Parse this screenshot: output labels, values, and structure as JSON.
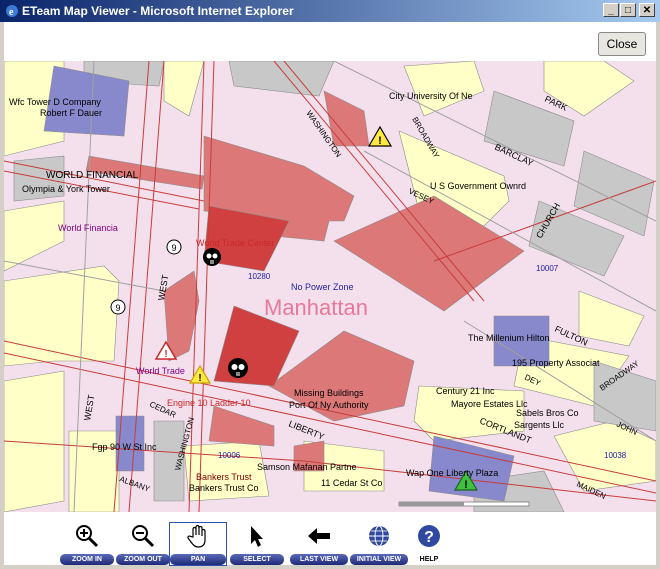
{
  "window": {
    "title": "ETeam Map Viewer - Microsoft Internet Explorer",
    "min": "_",
    "max": "□",
    "close": "✕"
  },
  "close_button": "Close",
  "map": {
    "labels": {
      "wfc_tower_d": "Wfc Tower D Company",
      "robert_dauer": "Robert F Dauer",
      "world_financial": "WORLD FINANCIAL",
      "olympia_york": "Olympia & York Tower",
      "world_financia_red": "World Financia",
      "city_university": "City University Of Ne",
      "washington_n": "WASHINGTON",
      "park": "PARK",
      "broadway": "BROADWAY",
      "barclay": "BARCLAY",
      "us_gov": "U S Government Ownrd",
      "vesey": "VESEY",
      "church": "CHURCH",
      "wtc": "World Trade Center",
      "zip_10280": "10280",
      "zip_10007": "10007",
      "no_power": "No Power Zone",
      "manhattan": "Manhattan",
      "west_1": "WEST",
      "west_2": "WEST",
      "fulton": "FULTON",
      "millenium": "The Millenium Hilton",
      "property_195": "195 Property Associat",
      "world_trade": "World Trade",
      "missing_buildings": "Missing Buildings",
      "port_ny": "Port Of Ny Authority",
      "dey": "DEY",
      "broadway_2": "BROADWAY",
      "century21": "Century 21 Inc",
      "mayore": "Mayore Estates Llc",
      "sabels": "Sabels Bros Co",
      "sargents": "Sargents Llc",
      "engine": "Engine  10 Ladder  10",
      "cedar": "CEDAR",
      "liberty": "LIBERTY",
      "cortlandt": "CORTLANDT",
      "john": "JOHN",
      "fgp": "Fgp 90 W St Inc",
      "zip_10006": "10006",
      "washington_s": "WASHINGTON",
      "samson": "Samson Mafanan Partne",
      "bankers_1": "Bankers Trust",
      "bankers_2": "Bankers Trust Co",
      "cedar_st": "11 Cedar St Co",
      "wap_liberty": "Wap One Liberty Plaza",
      "zip_10038": "10038",
      "albany": "ALBANY",
      "maiden": "MAIDEN",
      "route_9a": "9",
      "route_9b": "9"
    }
  },
  "toolbar": {
    "tools": [
      {
        "label": "ZOOM IN",
        "icon": "zoom-in-icon"
      },
      {
        "label": "ZOOM OUT",
        "icon": "zoom-out-icon"
      },
      {
        "label": "PAN",
        "icon": "hand-icon"
      },
      {
        "label": "SELECT",
        "icon": "arrow-pointer-icon"
      },
      {
        "label": "LAST VIEW",
        "icon": "back-arrow-icon"
      },
      {
        "label": "INITIAL VIEW",
        "icon": "globe-icon"
      },
      {
        "label": "HELP",
        "icon": "help-icon"
      }
    ]
  },
  "colors": {
    "map_background": "#f4e0ec",
    "block_yellow": "#ffffc8",
    "block_pink": "#dc7878",
    "block_red": "#d04040",
    "block_blue": "#8888cc",
    "block_gray": "#c8c8c8",
    "street_red": "#c83c3c",
    "label_red": "#c82828",
    "label_purple": "#800080",
    "label_blue": "#2020a0"
  }
}
